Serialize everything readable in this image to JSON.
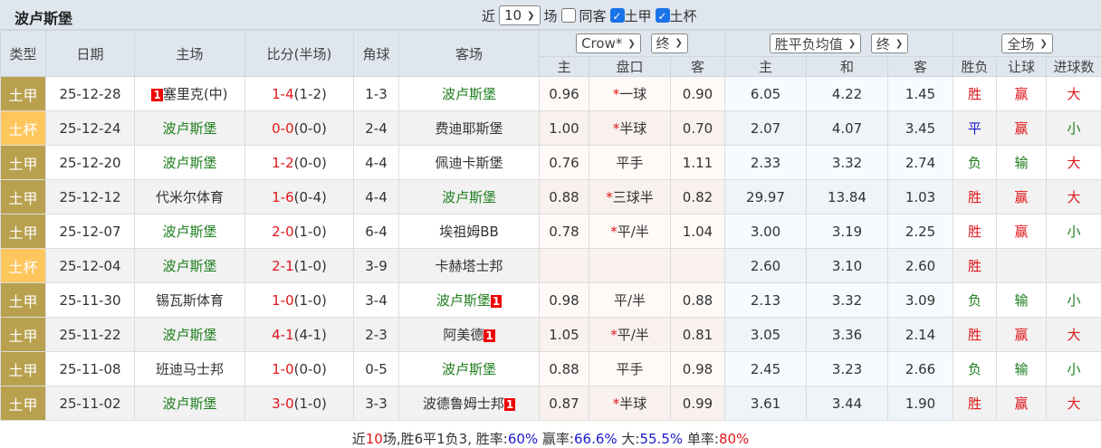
{
  "header": {
    "title": "波卢斯堡",
    "recent_prefix": "近",
    "recent_value": "10",
    "recent_suffix": "场",
    "same_away_label": "同客",
    "same_away_checked": false,
    "filter1_label": "土甲",
    "filter1_checked": true,
    "filter2_label": "土杯",
    "filter2_checked": true
  },
  "columns": {
    "type": "类型",
    "date": "日期",
    "home": "主场",
    "score": "比分(半场)",
    "corner": "角球",
    "away": "客场",
    "company": "Crow*",
    "company_time": "终",
    "avg": "胜平负均值",
    "avg_time": "终",
    "scope": "全场",
    "ah_home": "主",
    "ah_line": "盘口",
    "ah_away": "客",
    "eu_home": "主",
    "eu_draw": "和",
    "eu_away": "客",
    "res": "胜负",
    "handicap": "让球",
    "goals": "进球数"
  },
  "colors": {
    "league_tj": "#b8a04e",
    "league_tb": "#fec65d",
    "team_highlight": "#1e7e1e",
    "win": "#e0161b",
    "draw": "#1a1ad0",
    "loss": "#1e7e1e"
  },
  "rows": [
    {
      "type": "土甲",
      "date": "25-12-28",
      "home": "塞里克(中)",
      "home_rc": "1",
      "home_hl": false,
      "score": "1-4",
      "half": "(1-2)",
      "corner": "1-3",
      "away": "波卢斯堡",
      "away_hl": true,
      "away_rc": "",
      "ah_h": "0.96",
      "ah_star": true,
      "ah_line": "一球",
      "ah_a": "0.90",
      "eu_h": "6.05",
      "eu_d": "4.22",
      "eu_a": "1.45",
      "res": "胜",
      "hc": "赢",
      "goals": "大"
    },
    {
      "type": "土杯",
      "date": "25-12-24",
      "home": "波卢斯堡",
      "home_rc": "",
      "home_hl": true,
      "score": "0-0",
      "half": "(0-0)",
      "corner": "2-4",
      "away": "费迪耶斯堡",
      "away_hl": false,
      "away_rc": "",
      "ah_h": "1.00",
      "ah_star": true,
      "ah_line": "半球",
      "ah_a": "0.70",
      "eu_h": "2.07",
      "eu_d": "4.07",
      "eu_a": "3.45",
      "res": "平",
      "hc": "赢",
      "goals": "小"
    },
    {
      "type": "土甲",
      "date": "25-12-20",
      "home": "波卢斯堡",
      "home_rc": "",
      "home_hl": true,
      "score": "1-2",
      "half": "(0-0)",
      "corner": "4-4",
      "away": "佩迪卡斯堡",
      "away_hl": false,
      "away_rc": "",
      "ah_h": "0.76",
      "ah_star": false,
      "ah_line": "平手",
      "ah_a": "1.11",
      "eu_h": "2.33",
      "eu_d": "3.32",
      "eu_a": "2.74",
      "res": "负",
      "hc": "输",
      "goals": "大"
    },
    {
      "type": "土甲",
      "date": "25-12-12",
      "home": "代米尔体育",
      "home_rc": "",
      "home_hl": false,
      "score": "1-6",
      "half": "(0-4)",
      "corner": "4-4",
      "away": "波卢斯堡",
      "away_hl": true,
      "away_rc": "",
      "ah_h": "0.88",
      "ah_star": true,
      "ah_line": "三球半",
      "ah_a": "0.82",
      "eu_h": "29.97",
      "eu_d": "13.84",
      "eu_a": "1.03",
      "res": "胜",
      "hc": "赢",
      "goals": "大"
    },
    {
      "type": "土甲",
      "date": "25-12-07",
      "home": "波卢斯堡",
      "home_rc": "",
      "home_hl": true,
      "score": "2-0",
      "half": "(1-0)",
      "corner": "6-4",
      "away": "埃祖姆BB",
      "away_hl": false,
      "away_rc": "",
      "ah_h": "0.78",
      "ah_star": true,
      "ah_line": "平/半",
      "ah_a": "1.04",
      "eu_h": "3.00",
      "eu_d": "3.19",
      "eu_a": "2.25",
      "res": "胜",
      "hc": "赢",
      "goals": "小"
    },
    {
      "type": "土杯",
      "date": "25-12-04",
      "home": "波卢斯堡",
      "home_rc": "",
      "home_hl": true,
      "score": "2-1",
      "half": "(1-0)",
      "corner": "3-9",
      "away": "卡赫塔士邦",
      "away_hl": false,
      "away_rc": "",
      "ah_h": "",
      "ah_star": false,
      "ah_line": "",
      "ah_a": "",
      "eu_h": "2.60",
      "eu_d": "3.10",
      "eu_a": "2.60",
      "res": "胜",
      "hc": "",
      "goals": ""
    },
    {
      "type": "土甲",
      "date": "25-11-30",
      "home": "锡瓦斯体育",
      "home_rc": "",
      "home_hl": false,
      "score": "1-0",
      "half": "(1-0)",
      "corner": "3-4",
      "away": "波卢斯堡",
      "away_hl": true,
      "away_rc": "1",
      "ah_h": "0.98",
      "ah_star": false,
      "ah_line": "平/半",
      "ah_a": "0.88",
      "eu_h": "2.13",
      "eu_d": "3.32",
      "eu_a": "3.09",
      "res": "负",
      "hc": "输",
      "goals": "小"
    },
    {
      "type": "土甲",
      "date": "25-11-22",
      "home": "波卢斯堡",
      "home_rc": "",
      "home_hl": true,
      "score": "4-1",
      "half": "(4-1)",
      "corner": "2-3",
      "away": "阿美德",
      "away_hl": false,
      "away_rc": "1",
      "ah_h": "1.05",
      "ah_star": true,
      "ah_line": "平/半",
      "ah_a": "0.81",
      "eu_h": "3.05",
      "eu_d": "3.36",
      "eu_a": "2.14",
      "res": "胜",
      "hc": "赢",
      "goals": "大"
    },
    {
      "type": "土甲",
      "date": "25-11-08",
      "home": "班迪马士邦",
      "home_rc": "",
      "home_hl": false,
      "score": "1-0",
      "half": "(0-0)",
      "corner": "0-5",
      "away": "波卢斯堡",
      "away_hl": true,
      "away_rc": "",
      "ah_h": "0.88",
      "ah_star": false,
      "ah_line": "平手",
      "ah_a": "0.98",
      "eu_h": "2.45",
      "eu_d": "3.23",
      "eu_a": "2.66",
      "res": "负",
      "hc": "输",
      "goals": "小"
    },
    {
      "type": "土甲",
      "date": "25-11-02",
      "home": "波卢斯堡",
      "home_rc": "",
      "home_hl": true,
      "score": "3-0",
      "half": "(1-0)",
      "corner": "3-3",
      "away": "波德鲁姆士邦",
      "away_hl": false,
      "away_rc": "1",
      "ah_h": "0.87",
      "ah_star": true,
      "ah_line": "半球",
      "ah_a": "0.99",
      "eu_h": "3.61",
      "eu_d": "3.44",
      "eu_a": "1.90",
      "res": "胜",
      "hc": "赢",
      "goals": "大"
    }
  ],
  "summary": {
    "p1": "近",
    "n": "10",
    "p2": "场,胜6平1负3, 胜率:",
    "win_rate": "60%",
    "p3": " 赢率:",
    "hc_rate": "66.6%",
    "p4": " 大:",
    "big_rate": "55.5%",
    "p5": " 单率:",
    "odd_rate": "80%"
  }
}
